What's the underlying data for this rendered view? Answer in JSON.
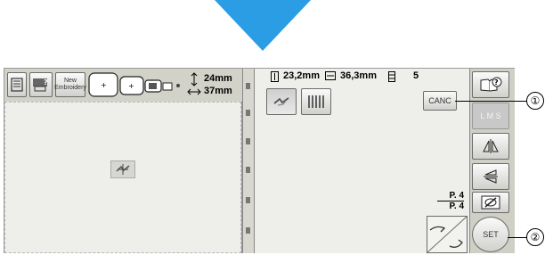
{
  "toolbar": {
    "new_embroidery_label_1": "New",
    "new_embroidery_label_2": "Embroidery",
    "height_value": "24mm",
    "width_value": "37mm"
  },
  "info": {
    "height_value": "23,2mm",
    "width_value": "36,3mm",
    "color_count": "5"
  },
  "buttons": {
    "cancel_label": "CANC",
    "lms_label": "L M S",
    "set_label": "SET"
  },
  "page": {
    "current": "P. 4",
    "total": "P. 4"
  },
  "callouts": {
    "one": "①",
    "two": "②"
  },
  "colors": {
    "arrow": "#2a9de5",
    "frame": "#9a9a9a",
    "pane": "#eeeeea"
  }
}
